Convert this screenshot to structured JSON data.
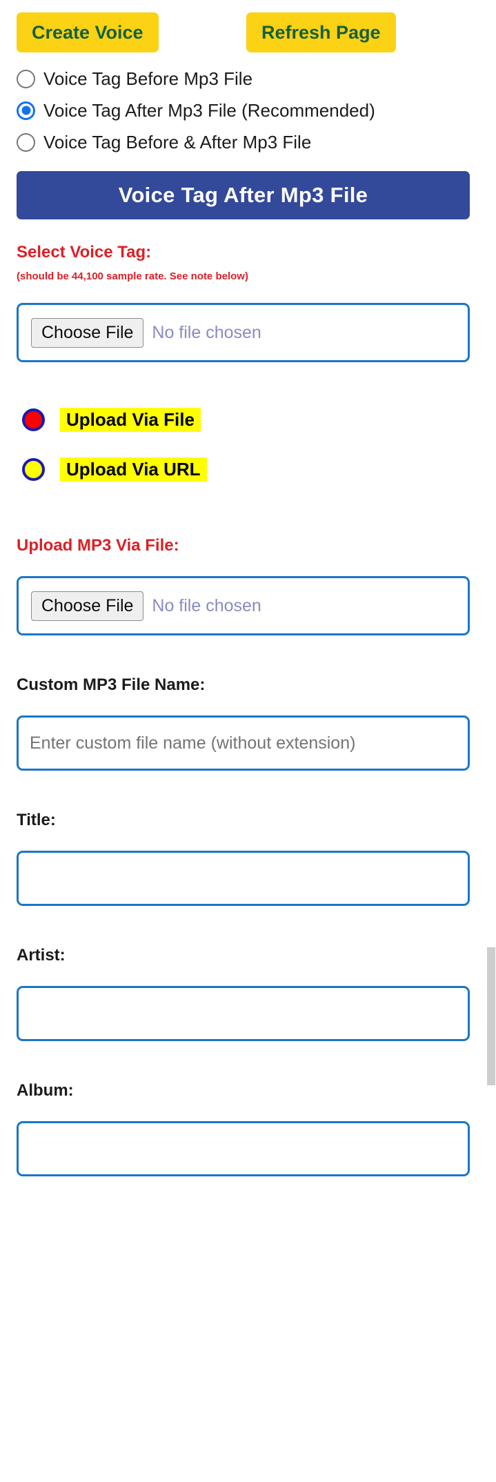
{
  "toolbar": {
    "create_voice_label": "Create Voice",
    "refresh_page_label": "Refresh Page"
  },
  "voice_tag_position": {
    "options": [
      {
        "label": "Voice Tag Before Mp3 File",
        "selected": false
      },
      {
        "label": "Voice Tag After Mp3 File (Recommended)",
        "selected": true
      },
      {
        "label": "Voice Tag Before & After Mp3 File",
        "selected": false
      }
    ],
    "banner_label": "Voice Tag After Mp3 File"
  },
  "select_voice_tag": {
    "heading": "Select Voice Tag:",
    "note": "(should be 44,100 sample rate. See note below)",
    "choose_file_label": "Choose File",
    "file_status": "No file chosen"
  },
  "upload_method": {
    "options": [
      {
        "label": "Upload Via File",
        "selected": true
      },
      {
        "label": "Upload Via URL",
        "selected": false
      }
    ]
  },
  "upload_mp3": {
    "heading": "Upload MP3 Via File:",
    "choose_file_label": "Choose File",
    "file_status": "No file chosen"
  },
  "custom_name": {
    "heading": "Custom MP3 File Name:",
    "placeholder": "Enter custom file name (without extension)",
    "value": ""
  },
  "metadata": {
    "title": {
      "heading": "Title:",
      "value": "",
      "placeholder": ""
    },
    "artist": {
      "heading": "Artist:",
      "value": "",
      "placeholder": ""
    },
    "album": {
      "heading": "Album:",
      "value": "",
      "placeholder": ""
    }
  },
  "colors": {
    "button_yellow": "#fbd214",
    "button_text_green": "#16603c",
    "banner_blue": "#33499a",
    "heading_red": "#dc1f26",
    "input_border_blue": "#1976c8",
    "highlight_yellow": "#ffff00",
    "radio_ring_blue": "#1a1ab0",
    "radio_fill_red": "#fb0000",
    "native_radio_blue": "#1573e6",
    "scrollbar_thumb": "#cdcdcd"
  }
}
